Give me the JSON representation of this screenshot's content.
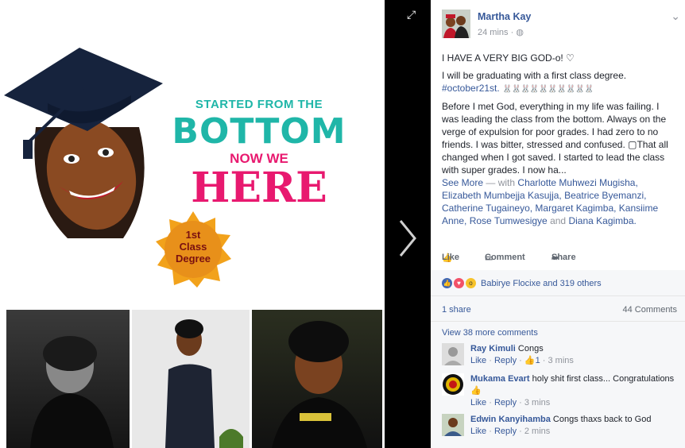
{
  "photo": {
    "graphic_line1": "STARTED FROM THE",
    "graphic_line2": "BOTTOM",
    "graphic_line3": "NOW WE",
    "graphic_line4": "HERE",
    "badge_line1": "1st",
    "badge_line2": "Class",
    "badge_line3": "Degree"
  },
  "post": {
    "author": "Martha Kay",
    "time": "24 mins",
    "line1": "I HAVE A VERY BIG GOD-o! ♡",
    "line2": "I will be graduating with a first class degree.",
    "hashtag": "#october21st.",
    "emoji_row": "🐰🐰🐰🐰🐰🐰🐰🐰🐰🐰",
    "body": "Before I met God, everything in my life was failing. I was leading the class from the bottom. Always on the verge of expulsion for poor grades. I had zero to no friends. I was bitter, stressed and confused. ▢That all changed when I got saved. I started to lead the class with super grades. I now ha...",
    "see_more": "See More",
    "with_prefix": "— with",
    "tags": "Charlotte Muhwezi Mugisha, Elizabeth Mumbejja Kasujja, Beatrice Byemanzi, Catherine Tugaineyo, Margaret Kagimba, Kansiime Anne, Rose Tumwesigye",
    "and": "and",
    "last_tag": "Diana Kagimba."
  },
  "actions": {
    "like": "Like",
    "comment": "Comment",
    "share": "Share"
  },
  "stats": {
    "reactions": "Babirye Flocixe and 319 others",
    "shares": "1 share",
    "comments": "44 Comments",
    "view_more": "View 38 more comments"
  },
  "comments": [
    {
      "name": "Ray Kimuli",
      "text": "Congs",
      "like": "Like",
      "reply": "Reply",
      "likes": "1",
      "time": "3 mins"
    },
    {
      "name": "Mukama Evart",
      "text": "holy shit first class... Congratulations",
      "like": "Like",
      "reply": "Reply",
      "time": "3 mins"
    },
    {
      "name": "Edwin Kanyihamba",
      "text": "Congs thaxs back to God",
      "like": "Like",
      "reply": "Reply",
      "time": "2 mins"
    }
  ],
  "colors": {
    "teal": "#1fb6a8",
    "pink": "#e8196f",
    "link": "#365899",
    "badge": "#f2a21b"
  }
}
